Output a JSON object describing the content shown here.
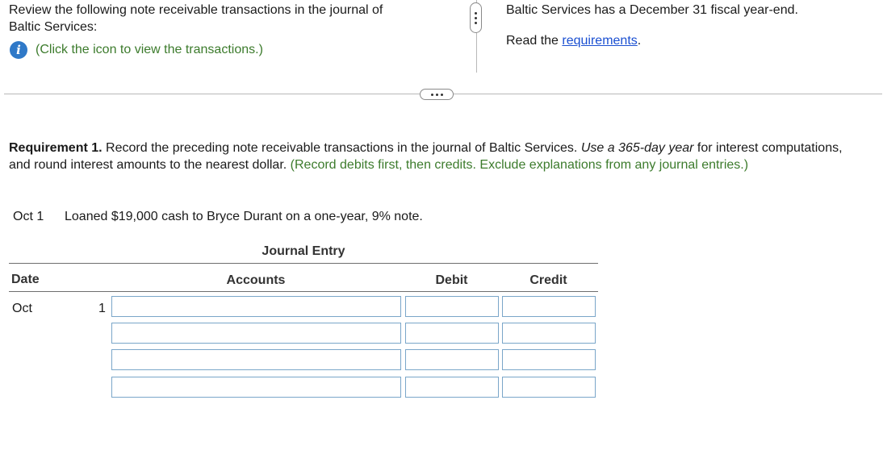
{
  "top_left": {
    "intro_line1": "Review the following note receivable transactions in the journal of",
    "intro_line2": "Baltic Services:",
    "info_icon": "info-icon",
    "info_icon_glyph": "i",
    "click_hint": "(Click the icon to view the transactions.)"
  },
  "top_right": {
    "fiscal_text": "Baltic Services has a December 31 fiscal year-end.",
    "read_prefix": "Read the ",
    "requirements_link": "requirements",
    "read_suffix": "."
  },
  "requirement": {
    "label": "Requirement 1.",
    "text1": " Record the preceding note receivable transactions in the journal of Baltic Services. ",
    "italic": "Use a 365-day year",
    "text2": " for interest computations, and round interest amounts to the nearest dollar.",
    "hint": "(Record debits first, then credits. Exclude explanations from any journal entries.)"
  },
  "transaction": {
    "date": "Oct 1",
    "description": "Loaned $19,000 cash to Bryce Durant on a one-year, 9% note."
  },
  "journal": {
    "title": "Journal Entry",
    "columns": {
      "date": "Date",
      "accounts": "Accounts",
      "debit": "Debit",
      "credit": "Credit"
    },
    "date_month": "Oct",
    "date_day": "1",
    "rows": [
      {
        "account": "",
        "debit": "",
        "credit": ""
      },
      {
        "account": "",
        "debit": "",
        "credit": ""
      },
      {
        "account": "",
        "debit": "",
        "credit": ""
      },
      {
        "account": "",
        "debit": "",
        "credit": ""
      }
    ]
  }
}
